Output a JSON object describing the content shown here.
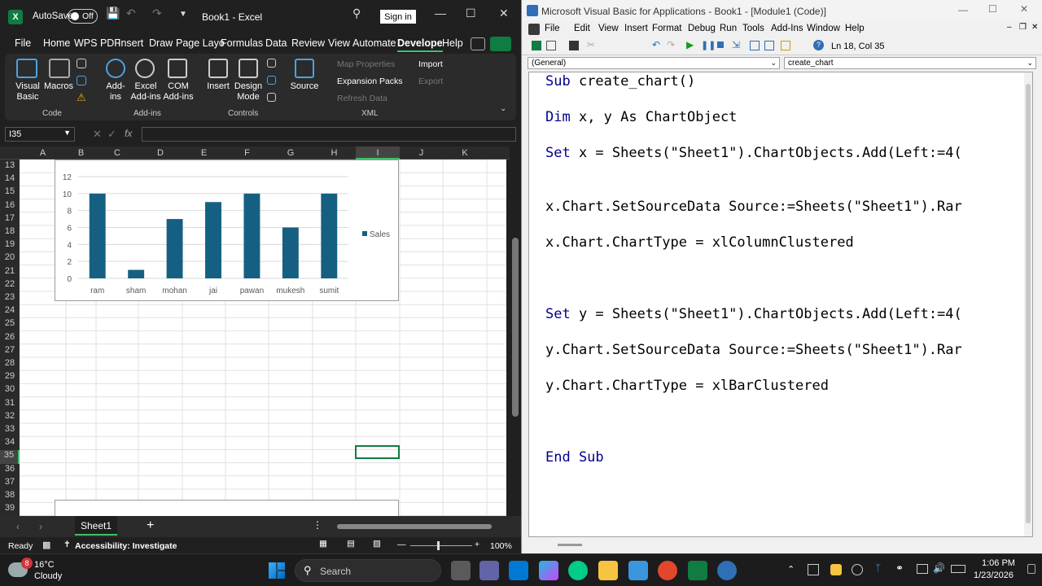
{
  "excel": {
    "autosave_label": "AutoSave",
    "autosave_state": "Off",
    "title": "Book1  -  Excel",
    "sign_in": "Sign in",
    "tabs": [
      "File",
      "Home",
      "WPS PDF",
      "Insert",
      "Draw",
      "Page Layo",
      "Formulas",
      "Data",
      "Review",
      "View",
      "Automate",
      "Develope",
      "Help"
    ],
    "active_tab": "Develope",
    "ribbon": {
      "visual_basic": "Visual Basic",
      "macros": "Macros",
      "group_code": "Code",
      "add_ins": "Add-ins",
      "excel_add_ins": "Excel Add-ins",
      "com_add_ins": "COM Add-ins",
      "group_add_ins": "Add-ins",
      "insert": "Insert",
      "design_mode": "Design Mode",
      "group_controls": "Controls",
      "source": "Source",
      "map_properties": "Map Properties",
      "expansion_packs": "Expansion Packs",
      "refresh_data": "Refresh Data",
      "import": "Import",
      "export": "Export",
      "group_xml": "XML"
    },
    "name_box": "I35",
    "fx": "fx",
    "columns": [
      "A",
      "B",
      "C",
      "D",
      "E",
      "F",
      "G",
      "H",
      "I",
      "J",
      "K"
    ],
    "rows": [
      "13",
      "14",
      "15",
      "16",
      "17",
      "18",
      "19",
      "20",
      "21",
      "22",
      "23",
      "24",
      "25",
      "26",
      "27",
      "28",
      "29",
      "30",
      "31",
      "32",
      "33",
      "34",
      "35",
      "36",
      "37",
      "38",
      "39"
    ],
    "sheet_tab": "Sheet1",
    "status_ready": "Ready",
    "accessibility": "Accessibility: Investigate",
    "zoom": "100%"
  },
  "chart_data": {
    "type": "bar",
    "categories": [
      "ram",
      "sham",
      "mohan",
      "jai",
      "pawan",
      "mukesh",
      "sumit"
    ],
    "series": [
      {
        "name": "Sales",
        "values": [
          10,
          1,
          7,
          9,
          10,
          6,
          10
        ]
      }
    ],
    "yticks": [
      "0",
      "2",
      "4",
      "6",
      "8",
      "10",
      "12"
    ],
    "ylim": [
      0,
      12
    ],
    "legend": "right",
    "grid": true,
    "bar_color": "#156082"
  },
  "vba": {
    "title": "Microsoft Visual Basic for Applications - Book1 - [Module1 (Code)]",
    "menu": [
      "File",
      "Edit",
      "View",
      "Insert",
      "Format",
      "Debug",
      "Run",
      "Tools",
      "Add-Ins",
      "Window",
      "Help"
    ],
    "cursor_pos": "Ln 18, Col 35",
    "combo_left": "(General)",
    "combo_right": "create_chart",
    "code": [
      {
        "kw": "Sub",
        "rest": " create_chart()"
      },
      {
        "kw": "Dim",
        "rest": " x, y As ChartObject"
      },
      {
        "kw": "Set",
        "rest": " x = Sheets(\"Sheet1\").ChartObjects.Add(Left:=4("
      },
      {
        "kw": "",
        "rest": "x.Chart.SetSourceData Source:=Sheets(\"Sheet1\").Rar"
      },
      {
        "kw": "",
        "rest": "x.Chart.ChartType = xlColumnClustered"
      },
      {
        "kw": "Set",
        "rest": " y = Sheets(\"Sheet1\").ChartObjects.Add(Left:=4("
      },
      {
        "kw": "",
        "rest": "y.Chart.SetSourceData Source:=Sheets(\"Sheet1\").Rar"
      },
      {
        "kw": "",
        "rest": "y.Chart.ChartType = xlBarClustered"
      },
      {
        "kw": "End Sub",
        "rest": ""
      }
    ]
  },
  "taskbar": {
    "weather_temp": "16°C",
    "weather_desc": "Cloudy",
    "weather_badge": "8",
    "search": "Search",
    "time": "1:06 PM",
    "date": "1/23/2026"
  },
  "colors": {
    "accent_green": "#107c41",
    "chart_blue": "#156082",
    "vba_keyword": "#00008b"
  }
}
